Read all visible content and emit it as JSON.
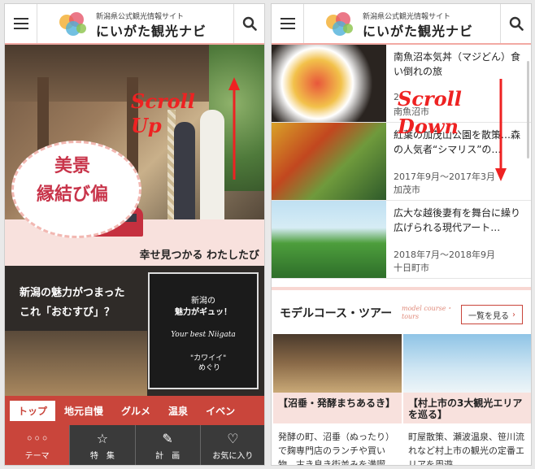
{
  "header": {
    "subtitle": "新潟県公式観光情報サイト",
    "site_name": "にいがた観光ナビ"
  },
  "left": {
    "hero": {
      "badge_line1": "美景",
      "badge_line2": "縁結び偏",
      "catch": "幸せ見つかる わたしたび",
      "annotation": "Scroll Up"
    },
    "promo": {
      "line1": "新潟の魅力がつまった",
      "line2": "これ「おむすび」？",
      "card_line1": "新潟の",
      "card_line2": "魅力がギュッ！",
      "card_line3": "Your best Niigata",
      "card_line4": "\"カワイイ\"",
      "card_line5": "めぐり"
    },
    "category_tabs": [
      "トップ",
      "地元自慢",
      "グルメ",
      "温泉",
      "イベン"
    ],
    "bottom_nav": [
      {
        "label": "テーマ",
        "icon": "dots-icon"
      },
      {
        "label": "特　集",
        "icon": "star-icon"
      },
      {
        "label": "計　画",
        "icon": "memo-icon"
      },
      {
        "label": "お気に入り",
        "icon": "heart-icon"
      }
    ]
  },
  "right": {
    "annotation": "Scroll Down",
    "articles": [
      {
        "title": "南魚沼本気丼（マジどん）食い倒れの旅",
        "date": "2",
        "place": "南魚沼市"
      },
      {
        "title": "紅葉の加茂山公園を散策…森の人気者“シマリス”の…",
        "date": "2017年9月～2017年3月",
        "place": "加茂市"
      },
      {
        "title": "広大な越後妻有を舞台に繰り広げられる現代アート…",
        "date": "2018年7月～2018年9月",
        "place": "十日町市"
      }
    ],
    "model_course": {
      "heading": "モデルコース・ツアー",
      "heading_en": "model course・tours",
      "more": "一覧を見る",
      "cards": [
        {
          "caption": "【沼垂・発酵まちあるき】",
          "desc": "発酵の町、沼垂（ぬったり）で麹専門店のランチや買い物、古き良き街並みを満喫。"
        },
        {
          "caption": "【村上市の3大観光エリアを巡る】",
          "desc": "町屋散策、瀬波温泉、笹川流れなど村上市の観光の定番エリアを周遊。"
        }
      ]
    }
  },
  "colors": {
    "accent": "#c9453b",
    "pink": "#f8e1dd",
    "annotation": "#e22222"
  }
}
